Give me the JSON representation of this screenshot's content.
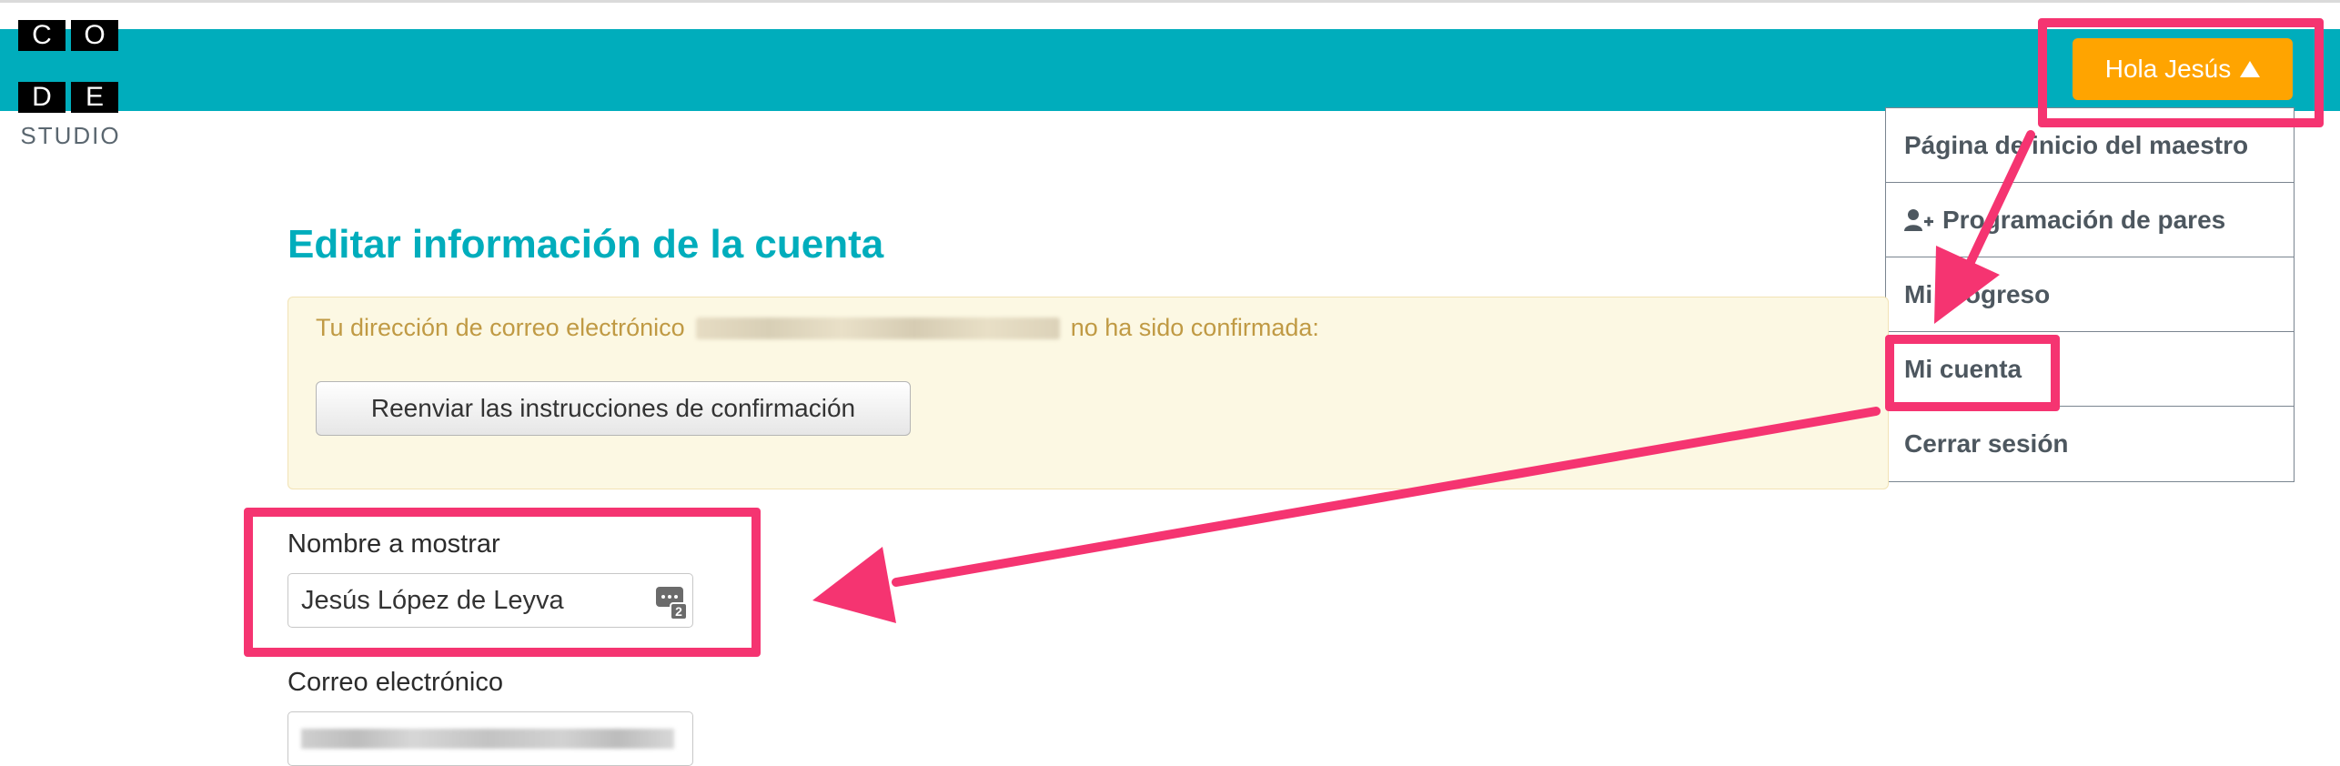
{
  "logo": {
    "letters": [
      "C",
      "O",
      "D",
      "E"
    ],
    "subtitle": "STUDIO"
  },
  "user_menu": {
    "button_label": "Hola Jesús",
    "items": [
      {
        "label": "Página de inicio del maestro"
      },
      {
        "label": "Programación de pares",
        "icon": "user-plus-icon"
      },
      {
        "label": "Mi progreso"
      },
      {
        "label": "Mi cuenta"
      },
      {
        "label": "Cerrar sesión"
      }
    ]
  },
  "page": {
    "title": "Editar información de la cuenta"
  },
  "alert": {
    "text_before": "Tu dirección de correo electrónico",
    "text_after": "no ha sido confirmada:",
    "resend_button": "Reenviar las instrucciones de confirmación"
  },
  "form": {
    "display_name_label": "Nombre a mostrar",
    "display_name_value": "Jesús López de Leyva",
    "email_label": "Correo electrónico"
  },
  "colors": {
    "header": "#00adbc",
    "accent_button": "#ffa400",
    "annotation": "#f53471",
    "alert_bg": "#fcf8e3",
    "alert_text": "#c09a44"
  }
}
